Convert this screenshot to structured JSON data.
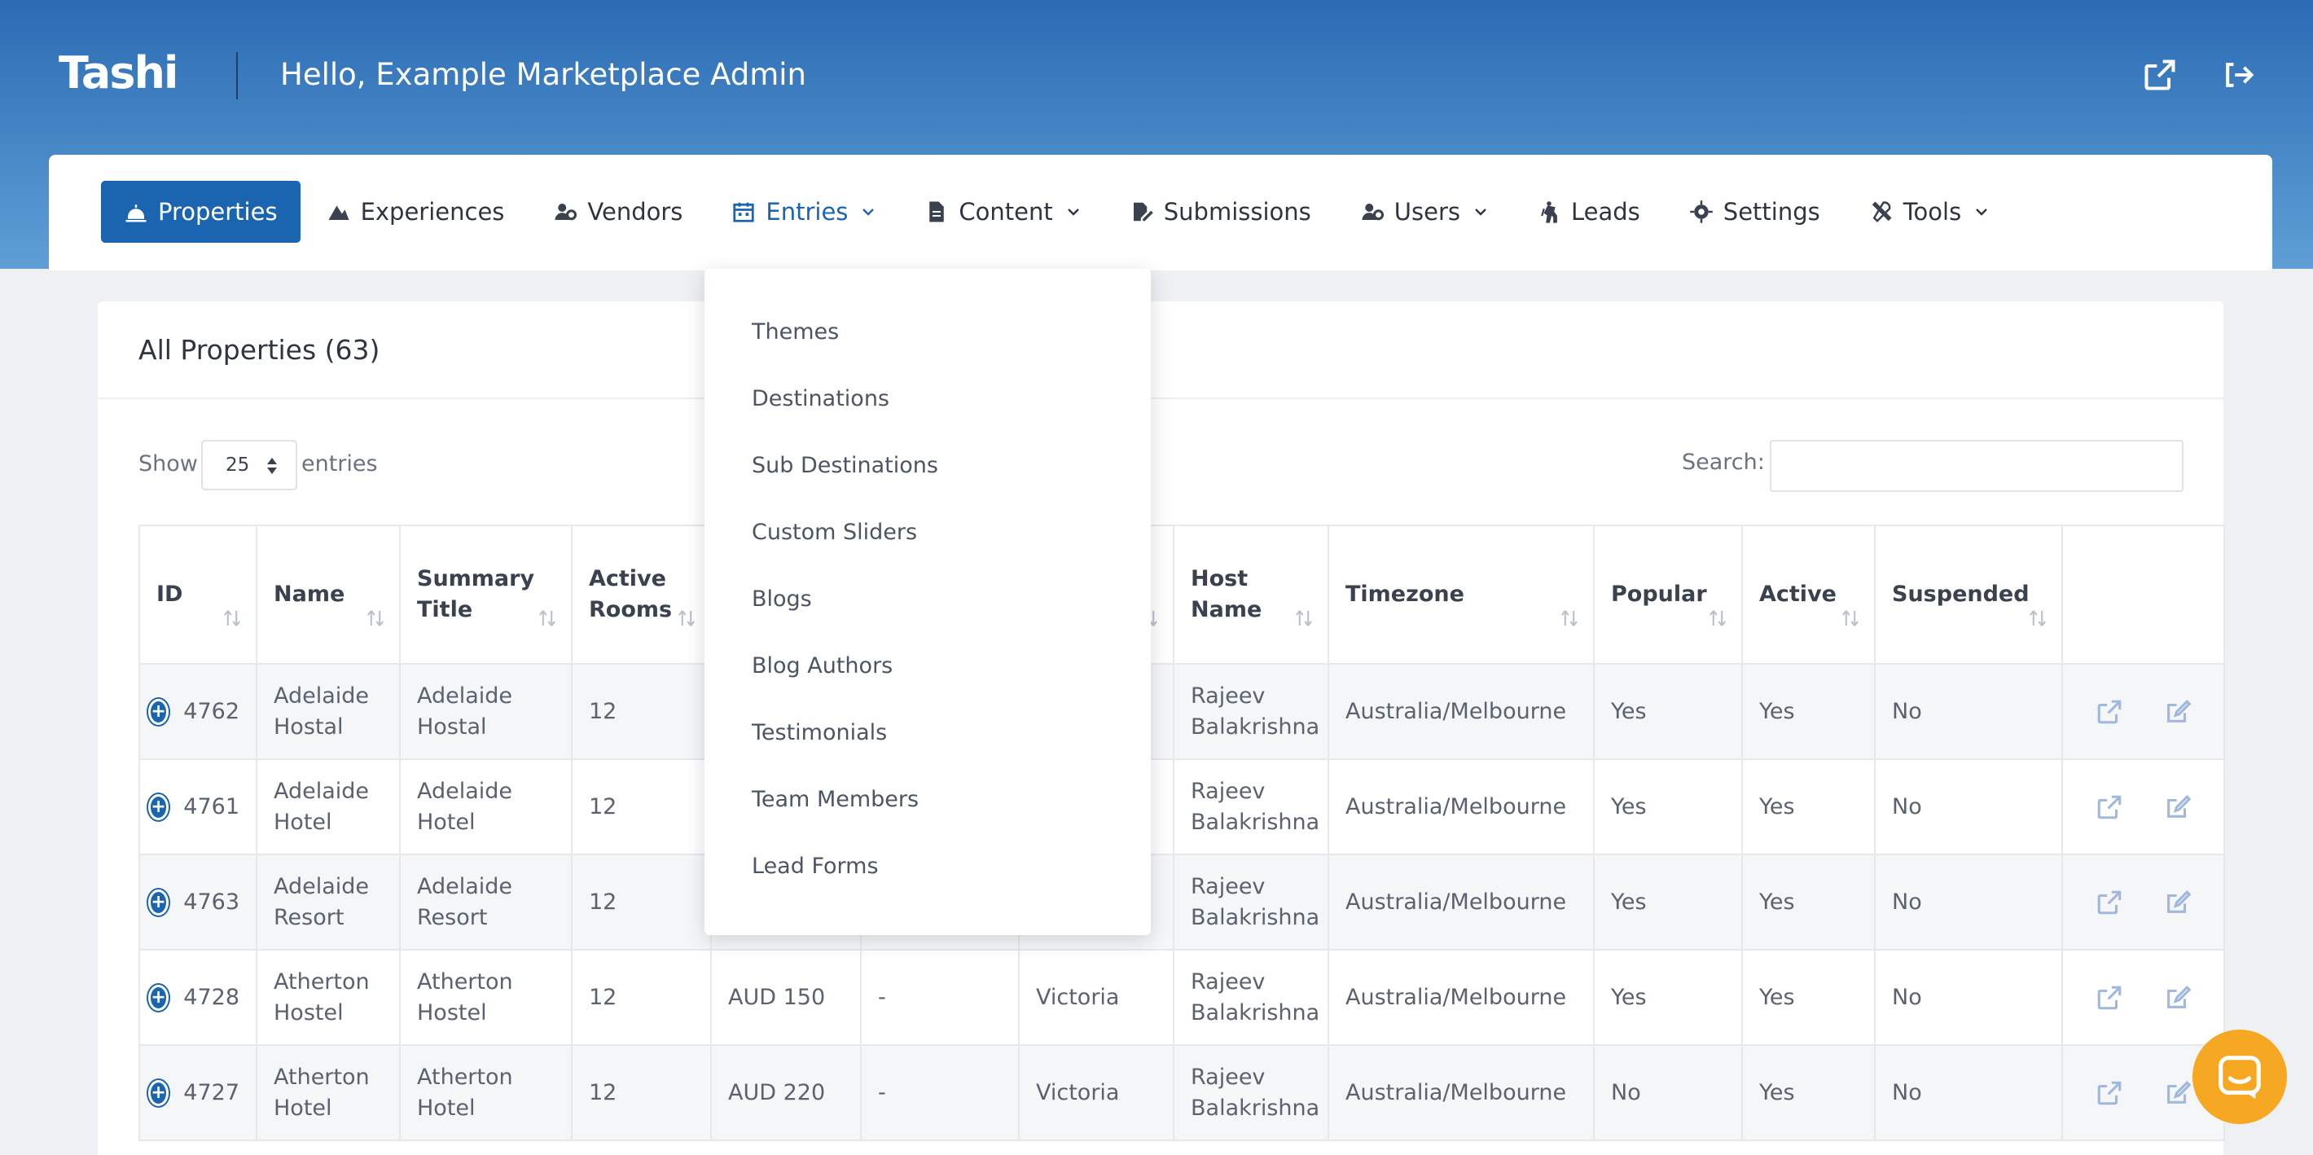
{
  "header": {
    "logo": "Tashi",
    "greeting": "Hello, Example Marketplace Admin"
  },
  "nav": [
    {
      "label": "Properties",
      "icon": "bell-icon",
      "active": true
    },
    {
      "label": "Experiences",
      "icon": "mountain-icon"
    },
    {
      "label": "Vendors",
      "icon": "users-gear-icon"
    },
    {
      "label": "Entries",
      "icon": "calendar-icon",
      "dropdown": true,
      "open": true
    },
    {
      "label": "Content",
      "icon": "file-icon",
      "dropdown": true
    },
    {
      "label": "Submissions",
      "icon": "edit-file-icon"
    },
    {
      "label": "Users",
      "icon": "users-gear-icon",
      "dropdown": true
    },
    {
      "label": "Leads",
      "icon": "hiker-icon"
    },
    {
      "label": "Settings",
      "icon": "gear-icon"
    },
    {
      "label": "Tools",
      "icon": "tools-icon",
      "dropdown": true
    }
  ],
  "entries_menu": [
    "Themes",
    "Destinations",
    "Sub Destinations",
    "Custom Sliders",
    "Blogs",
    "Blog Authors",
    "Testimonials",
    "Team Members",
    "Lead Forms"
  ],
  "card": {
    "title": "All Properties (63)",
    "show_label": "Show",
    "page_length": "25",
    "entries_label": "entries",
    "search_label": "Search:",
    "search_value": ""
  },
  "table": {
    "columns": [
      "ID",
      "Name",
      "Summary Title",
      "Active Rooms",
      "",
      "",
      "",
      "Host Name",
      "Timezone",
      "Popular",
      "Active",
      "Suspended",
      ""
    ],
    "rows": [
      [
        "4762",
        "Adelaide Hostal",
        "Adelaide Hostal",
        "12",
        "",
        "",
        "",
        "Rajeev Balakrishna",
        "Australia/Melbourne",
        "Yes",
        "Yes",
        "No"
      ],
      [
        "4761",
        "Adelaide Hotel",
        "Adelaide Hotel",
        "12",
        "",
        "",
        "",
        "Rajeev Balakrishna",
        "Australia/Melbourne",
        "Yes",
        "Yes",
        "No"
      ],
      [
        "4763",
        "Adelaide Resort",
        "Adelaide Resort",
        "12",
        "",
        "",
        "",
        "Rajeev Balakrishna",
        "Australia/Melbourne",
        "Yes",
        "Yes",
        "No"
      ],
      [
        "4728",
        "Atherton Hostel",
        "Atherton Hostel",
        "12",
        "AUD 150",
        "-",
        "Victoria",
        "Rajeev Balakrishna",
        "Australia/Melbourne",
        "Yes",
        "Yes",
        "No"
      ],
      [
        "4727",
        "Atherton Hotel",
        "Atherton Hotel",
        "12",
        "AUD 220",
        "-",
        "Victoria",
        "Rajeev Balakrishna",
        "Australia/Melbourne",
        "No",
        "Yes",
        "No"
      ]
    ]
  },
  "colors": {
    "primary": "#1a64b0",
    "header_top": "#2b6bb3",
    "header_bottom": "#5f9fd6",
    "chat": "#f7a823"
  }
}
